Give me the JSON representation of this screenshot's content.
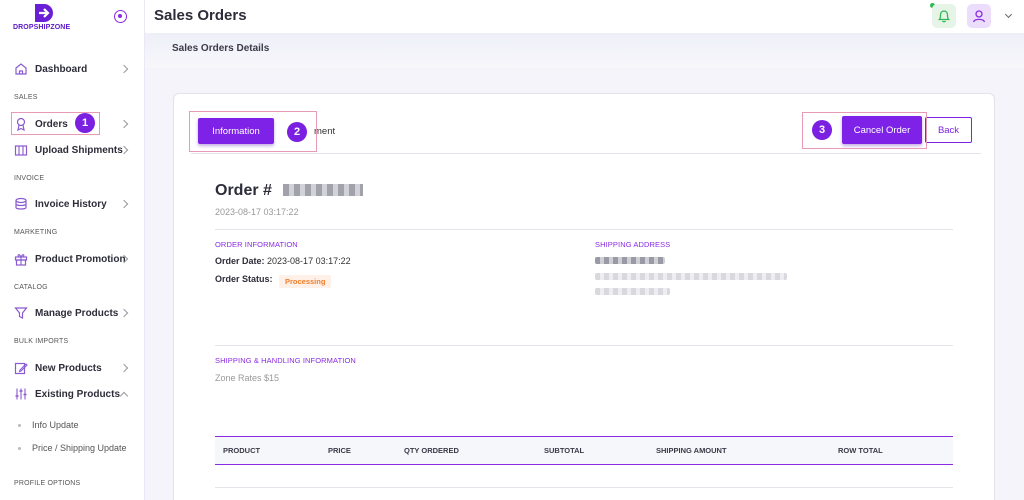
{
  "brand": {
    "name": "DROPSHIPZONE"
  },
  "header": {
    "title": "Sales Orders",
    "subtitle": "Sales Orders Details"
  },
  "sidebar": {
    "items": [
      {
        "label": "Dashboard",
        "icon": "home-icon",
        "section": ""
      },
      {
        "label": "Orders",
        "icon": "award-icon",
        "section": "SALES"
      },
      {
        "label": "Upload Shipments",
        "icon": "box-icon",
        "section": ""
      },
      {
        "label": "Invoice History",
        "icon": "database-icon",
        "section": "INVOICE"
      },
      {
        "label": "Product Promotion",
        "icon": "gift-icon",
        "section": "MARKETING"
      },
      {
        "label": "Manage Products",
        "icon": "filter-icon",
        "section": "CATALOG"
      },
      {
        "label": "New Products",
        "icon": "edit-icon",
        "section": "BULK IMPORTS"
      },
      {
        "label": "Existing Products",
        "icon": "sliders-icon",
        "section": ""
      }
    ],
    "sections": [
      "SALES",
      "INVOICE",
      "MARKETING",
      "CATALOG",
      "BULK IMPORTS",
      "PROFILE OPTIONS"
    ],
    "subitems": [
      "Info Update",
      "Price / Shipping Update"
    ]
  },
  "annotations": [
    "1",
    "2",
    "3"
  ],
  "tabs": {
    "information": "Information",
    "shipment": "ment"
  },
  "actions": {
    "cancel": "Cancel Order",
    "back": "Back"
  },
  "order": {
    "title": "Order #",
    "created": "2023-08-17 03:17:22",
    "info_label": "ORDER INFORMATION",
    "date_label": "Order Date:",
    "date_value": "2023-08-17 03:17:22",
    "status_label": "Order Status:",
    "status_value": "Processing",
    "shipping_label": "SHIPPING ADDRESS",
    "handling_label": "SHIPPING & HANDLING INFORMATION",
    "handling_value": "Zone Rates $15"
  },
  "table": {
    "headers": [
      "PRODUCT",
      "PRICE",
      "QTY ORDERED",
      "SUBTOTAL",
      "SHIPPING AMOUNT",
      "ROW TOTAL"
    ]
  },
  "colors": {
    "accent": "#7d22e6",
    "status": "#f07d2a",
    "notify": "#2db84d"
  }
}
